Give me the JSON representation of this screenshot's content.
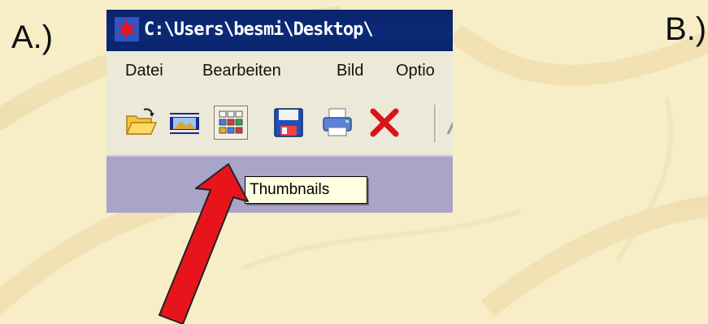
{
  "labels": {
    "a": "A.)",
    "b": "B.)"
  },
  "window": {
    "title": "C:\\Users\\besmi\\Desktop\\"
  },
  "menu": {
    "items": [
      "Datei",
      "Bearbeiten",
      "Bild",
      "Optio"
    ]
  },
  "toolbar": {
    "tools": [
      "open-folder-icon",
      "slideshow-icon",
      "thumbnails-icon",
      "save-icon",
      "print-icon",
      "delete-icon"
    ],
    "hovered": "thumbnails-icon"
  },
  "tooltip": {
    "text": "Thumbnails"
  },
  "colors": {
    "background": "#f7eec8",
    "titlebar": "#0a246a",
    "chrome": "#ece9d8",
    "workspace": "#a9a5c9",
    "tooltip": "#ffffe1",
    "arrow": "#e8141c"
  }
}
